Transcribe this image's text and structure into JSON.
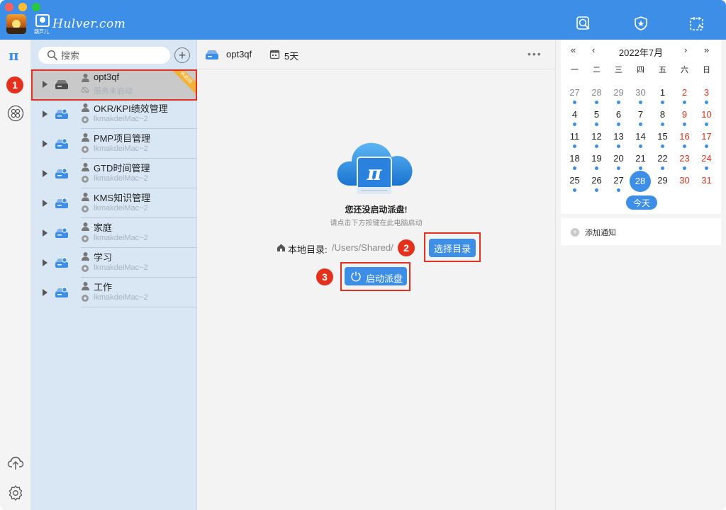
{
  "titlebar": {
    "logo_text": "Hulver.com",
    "logo_sub": "葫芦儿"
  },
  "rail": {
    "logo_glyph": "π",
    "icons": [
      "pi-logo-icon",
      "apps-grid-icon",
      "cloud-upload-icon",
      "settings-icon"
    ]
  },
  "sidebar": {
    "search_placeholder": "搜索",
    "add_label": "+",
    "items": [
      {
        "title": "opt3qf",
        "sub": "服务未启动",
        "ribbon": "未启动"
      },
      {
        "title": "OKR/KPI绩效管理",
        "sub": "lkmakdeiMac~2"
      },
      {
        "title": "PMP项目管理",
        "sub": "lkmakdeiMac~2"
      },
      {
        "title": "GTD时间管理",
        "sub": "lkmakdeiMac~2"
      },
      {
        "title": "KMS知识管理",
        "sub": "lkmakdeiMac~2"
      },
      {
        "title": "家庭",
        "sub": "lkmakdeiMac~2"
      },
      {
        "title": "学习",
        "sub": "lkmakdeiMac~2"
      },
      {
        "title": "工作",
        "sub": "lkmakdeiMac~2"
      }
    ]
  },
  "main": {
    "header_name": "opt3qf",
    "header_days": "5天",
    "more_label": "•••",
    "empty_title": "您还没启动派盘!",
    "empty_sub": "请点击下方按键在此电脑启动",
    "dir_label": "本地目录:",
    "dir_value": "/Users/Shared/",
    "select_dir_label": "选择目录",
    "start_label": "启动派盘"
  },
  "badges": [
    "1",
    "2",
    "3"
  ],
  "calendar": {
    "title": "2022年7月",
    "nav_prev_year": "«",
    "nav_prev_month": "‹",
    "nav_next_month": "›",
    "nav_next_year": "»",
    "weekdays": [
      "一",
      "二",
      "三",
      "四",
      "五",
      "六",
      "日"
    ],
    "days": [
      {
        "d": "27",
        "other": true,
        "dot": true
      },
      {
        "d": "28",
        "other": true,
        "dot": true
      },
      {
        "d": "29",
        "other": true,
        "dot": true
      },
      {
        "d": "30",
        "other": true,
        "dot": true
      },
      {
        "d": "1",
        "dot": true
      },
      {
        "d": "2",
        "weekend": true,
        "dot": true
      },
      {
        "d": "3",
        "weekend": true,
        "dot": true
      },
      {
        "d": "4",
        "dot": true
      },
      {
        "d": "5",
        "dot": true
      },
      {
        "d": "6",
        "dot": true
      },
      {
        "d": "7",
        "dot": true
      },
      {
        "d": "8",
        "dot": true
      },
      {
        "d": "9",
        "weekend": true,
        "dot": true
      },
      {
        "d": "10",
        "weekend": true,
        "dot": true
      },
      {
        "d": "11",
        "dot": true
      },
      {
        "d": "12",
        "dot": true
      },
      {
        "d": "13",
        "dot": true
      },
      {
        "d": "14",
        "dot": true
      },
      {
        "d": "15",
        "dot": true
      },
      {
        "d": "16",
        "weekend": true,
        "dot": true
      },
      {
        "d": "17",
        "weekend": true,
        "dot": true
      },
      {
        "d": "18",
        "dot": true
      },
      {
        "d": "19",
        "dot": true
      },
      {
        "d": "20",
        "dot": true
      },
      {
        "d": "21",
        "dot": true
      },
      {
        "d": "22",
        "dot": true
      },
      {
        "d": "23",
        "weekend": true,
        "dot": true
      },
      {
        "d": "24",
        "weekend": true,
        "dot": true
      },
      {
        "d": "25",
        "dot": true
      },
      {
        "d": "26",
        "dot": true
      },
      {
        "d": "27",
        "dot": true
      },
      {
        "d": "28",
        "today": true
      },
      {
        "d": "29"
      },
      {
        "d": "30",
        "weekend": true
      },
      {
        "d": "31",
        "weekend": true
      }
    ],
    "today_label": "今天",
    "add_notice_label": "添加通知"
  },
  "colors": {
    "accent": "#3d8ee6",
    "badge": "#e3311d",
    "weekend": "#e3311d",
    "sidebar_bg": "#d9e7f5",
    "ribbon": "#f1b23a"
  }
}
